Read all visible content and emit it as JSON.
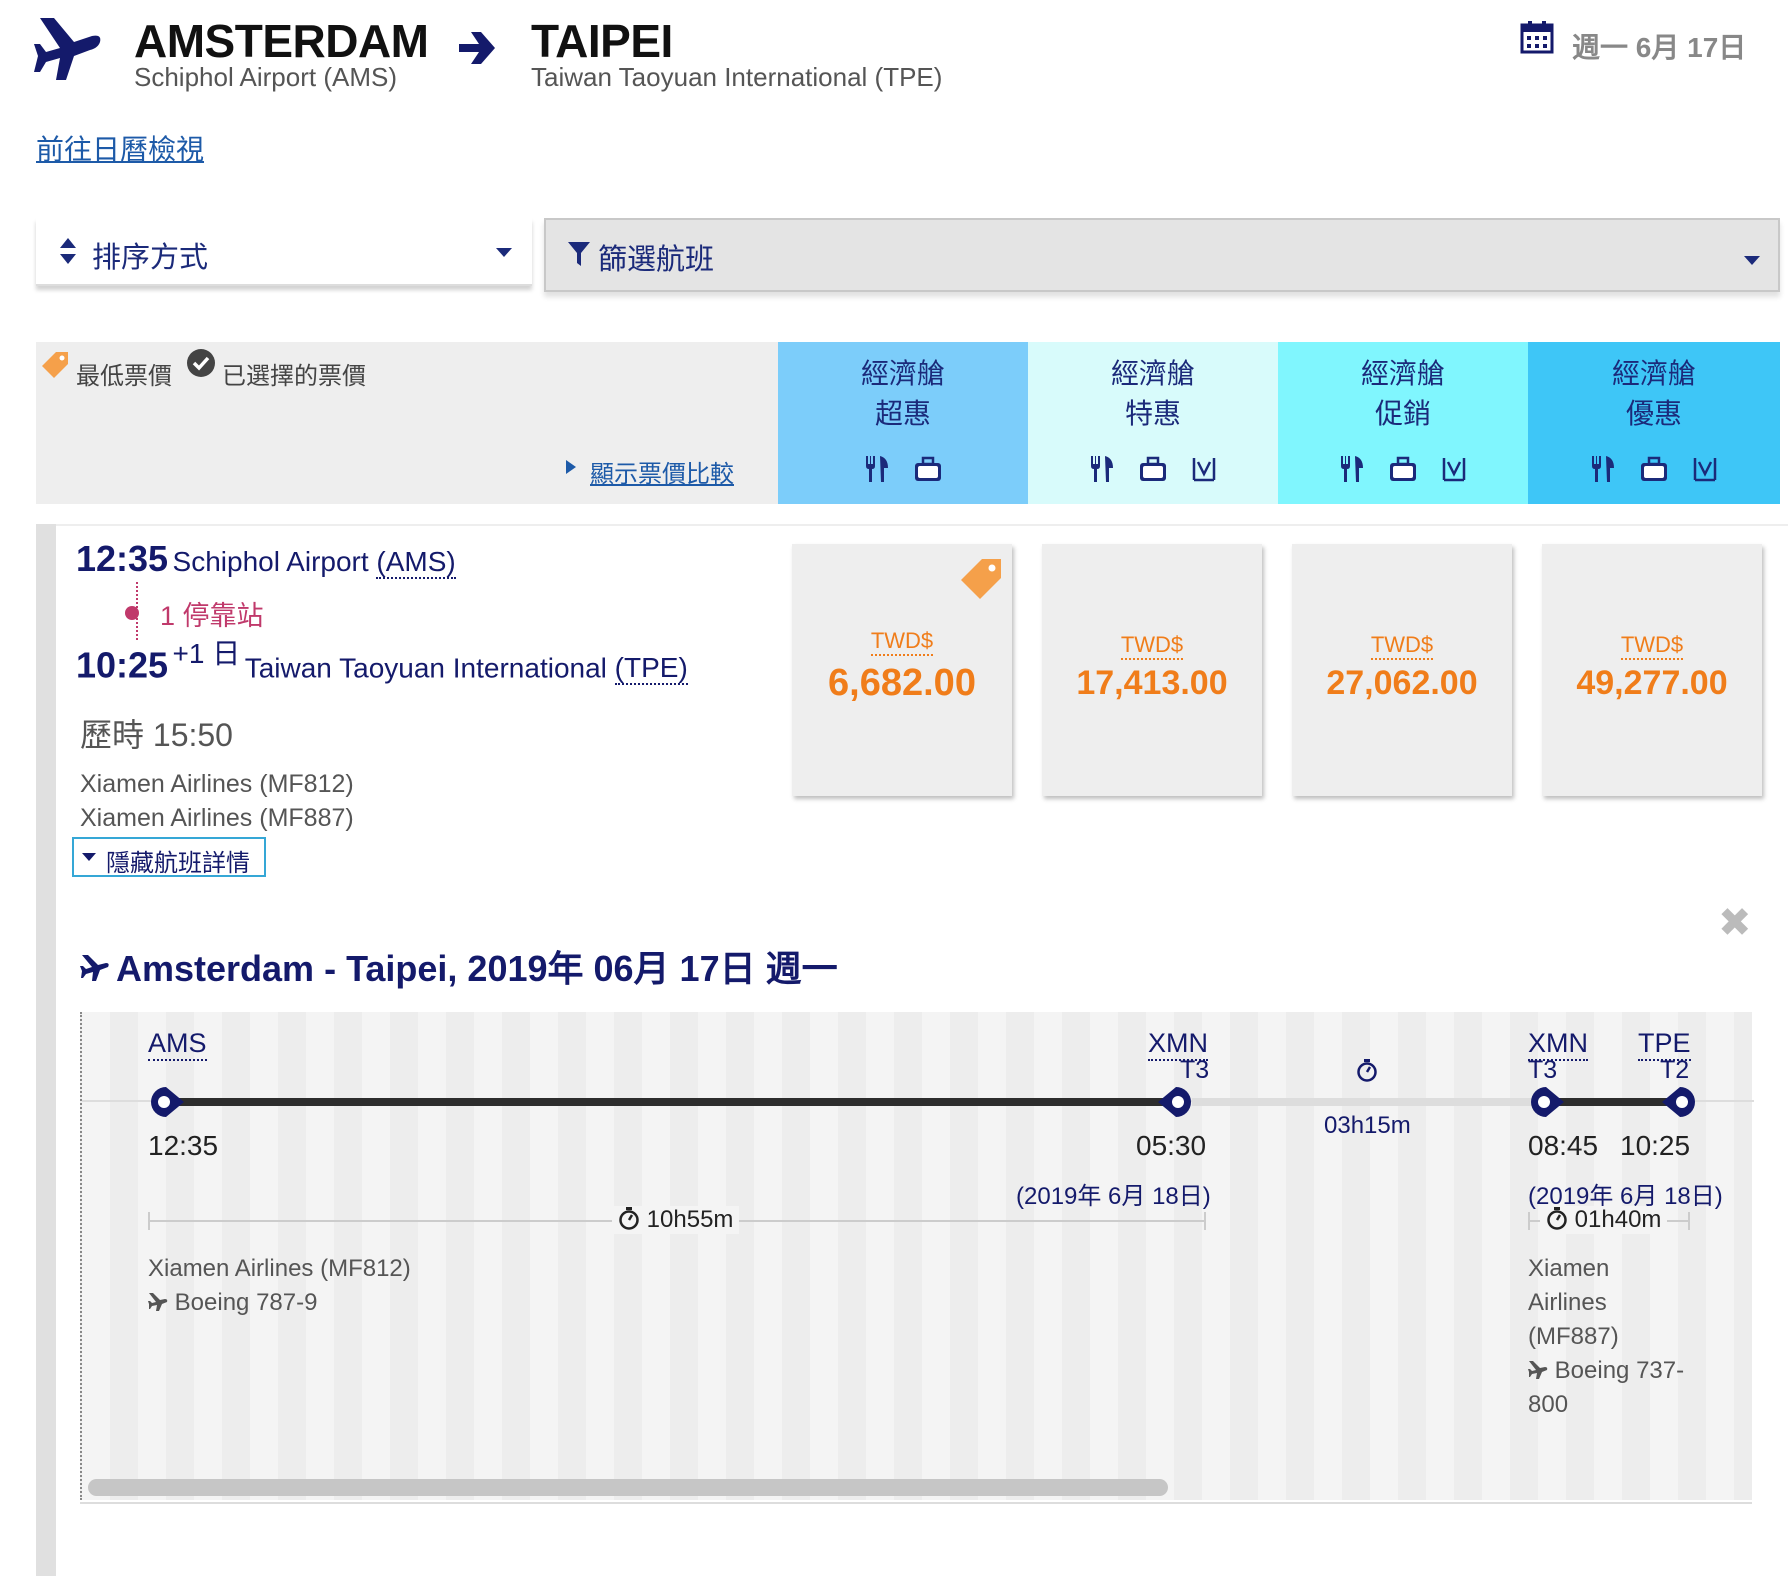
{
  "header": {
    "origin_city": "AMSTERDAM",
    "origin_airport": "Schiphol Airport (AMS)",
    "dest_city": "TAIPEI",
    "dest_airport": "Taiwan Taoyuan International (TPE)",
    "date": "週一 6月 17日",
    "calendar_link": "前往日曆檢視"
  },
  "controls": {
    "sort_label": "排序方式",
    "filter_label": "篩選航班"
  },
  "legend": {
    "lowest": "最低票價",
    "selected": "已選擇的票價",
    "compare": "顯示票價比較"
  },
  "fare_columns": [
    {
      "line1": "經濟艙",
      "line2": "超惠",
      "color": "#7ccdfa"
    },
    {
      "line1": "經濟艙",
      "line2": "特惠",
      "color": "#d8fbfb"
    },
    {
      "line1": "經濟艙",
      "line2": "促銷",
      "color": "#80f6fe"
    },
    {
      "line1": "經濟艙",
      "line2": "優惠",
      "color": "#3ec6f7"
    }
  ],
  "flight": {
    "depart_time": "12:35",
    "depart_airport": "Schiphol Airport ",
    "depart_code": "(AMS)",
    "stops": "1 停靠站",
    "arrive_time": "10:25",
    "arrive_plus": "+1 日",
    "arrive_airport": "Taiwan Taoyuan International ",
    "arrive_code": "(TPE)",
    "duration": "歷時 15:50",
    "airline1": "Xiamen Airlines (MF812)",
    "airline2": "Xiamen Airlines (MF887)",
    "hide_details": "隱藏航班詳情"
  },
  "prices": [
    {
      "currency": "TWD$",
      "amount": "6,682.00"
    },
    {
      "currency": "TWD$",
      "amount": "17,413.00"
    },
    {
      "currency": "TWD$",
      "amount": "27,062.00"
    },
    {
      "currency": "TWD$",
      "amount": "49,277.00"
    }
  ],
  "detail": {
    "title": "Amsterdam - Taipei, 2019年 06月 17日 週一",
    "close": "✖",
    "seg1": {
      "from_code": "AMS",
      "from_time": "12:35",
      "to_code": "XMN",
      "to_term": "T3",
      "to_time": "05:30",
      "to_date": "(2019年 6月 18日)",
      "duration": "10h55m",
      "airline": "Xiamen Airlines (MF812)",
      "aircraft": "Boeing 787-9"
    },
    "layover": "03h15m",
    "seg2": {
      "from_code": "XMN",
      "from_term": "T3",
      "from_time": "08:45",
      "to_code": "TPE",
      "to_term": "T2",
      "to_time": "10:25",
      "date": "(2019年 6月 18日)",
      "duration": "01h40m",
      "airline_l1": "Xiamen",
      "airline_l2": "Airlines",
      "airline_l3": "(MF887)",
      "aircraft_l1": "Boeing 737-",
      "aircraft_l2": "800"
    }
  },
  "colors": {
    "navy": "#141a6b",
    "orange": "#f07d1a",
    "stop_red": "#c0396b",
    "link_blue": "#1d5aa8"
  }
}
